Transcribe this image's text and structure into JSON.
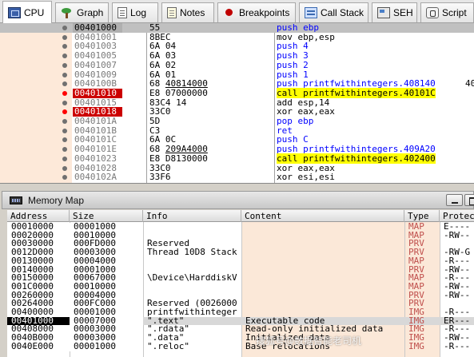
{
  "tabs": [
    {
      "label": "CPU",
      "icon": "cpu-icon",
      "active": true
    },
    {
      "label": "Graph",
      "icon": "graph-icon"
    },
    {
      "label": "Log",
      "icon": "log-icon"
    },
    {
      "label": "Notes",
      "icon": "notes-icon"
    },
    {
      "label": "Breakpoints",
      "icon": "breakpoints-icon"
    },
    {
      "label": "Call Stack",
      "icon": "call-stack-icon"
    },
    {
      "label": "SEH",
      "icon": "seh-icon"
    },
    {
      "label": "Script",
      "icon": "script-icon"
    }
  ],
  "disassembly": [
    {
      "addr": "00401000",
      "bytes": "55",
      "mnemonic": "push",
      "operand": "ebp",
      "kind": "push",
      "bp": false,
      "current": true
    },
    {
      "addr": "00401001",
      "bytes": "8BEC",
      "mnemonic": "mov",
      "operand": "ebp,esp",
      "kind": "plain",
      "bp": false
    },
    {
      "addr": "00401003",
      "bytes": "6A 04",
      "mnemonic": "push",
      "operand": "4",
      "kind": "push",
      "bp": false
    },
    {
      "addr": "00401005",
      "bytes": "6A 03",
      "mnemonic": "push",
      "operand": "3",
      "kind": "push",
      "bp": false
    },
    {
      "addr": "00401007",
      "bytes": "6A 02",
      "mnemonic": "push",
      "operand": "2",
      "kind": "push",
      "bp": false
    },
    {
      "addr": "00401009",
      "bytes": "6A 01",
      "mnemonic": "push",
      "operand": "1",
      "kind": "push",
      "bp": false
    },
    {
      "addr": "0040100B",
      "bytes": "68 ",
      "bytes_ul": "40814000",
      "mnemonic": "push",
      "operand": "printfwithintegers.408140",
      "kind": "push",
      "bp": false,
      "far": "40"
    },
    {
      "addr": "00401010",
      "bytes": "E8 07000000",
      "mnemonic": "call",
      "operand": "printfwithintegers.40101C",
      "kind": "call",
      "bp": true
    },
    {
      "addr": "00401015",
      "bytes": "83C4 14",
      "mnemonic": "add",
      "operand": "esp,14",
      "kind": "plain",
      "bp": false
    },
    {
      "addr": "00401018",
      "bytes": "33C0",
      "mnemonic": "xor",
      "operand": "eax,eax",
      "kind": "plain",
      "bp": true
    },
    {
      "addr": "0040101A",
      "bytes": "5D",
      "mnemonic": "pop",
      "operand": "ebp",
      "kind": "push",
      "bp": false
    },
    {
      "addr": "0040101B",
      "bytes": "C3",
      "mnemonic": "ret",
      "operand": "",
      "kind": "ret",
      "bp": false
    },
    {
      "addr": "0040101C",
      "bytes": "6A 0C",
      "mnemonic": "push",
      "operand": "C",
      "kind": "push",
      "bp": false
    },
    {
      "addr": "0040101E",
      "bytes": "68 ",
      "bytes_ul": "209A4000",
      "mnemonic": "push",
      "operand": "printfwithintegers.409A20",
      "kind": "push",
      "bp": false
    },
    {
      "addr": "00401023",
      "bytes": "E8 D8130000",
      "mnemonic": "call",
      "operand": "printfwithintegers.402400",
      "kind": "call",
      "bp": false
    },
    {
      "addr": "00401028",
      "bytes": "33C0",
      "mnemonic": "xor",
      "operand": "eax,eax",
      "kind": "plain",
      "bp": false
    },
    {
      "addr": "0040102A",
      "bytes": "33F6",
      "mnemonic": "xor",
      "operand": "esi,esi",
      "kind": "plain",
      "bp": false
    }
  ],
  "memory_map": {
    "title": "Memory Map",
    "columns": [
      "Address",
      "Size",
      "Info",
      "Content",
      "Type",
      "Protec"
    ],
    "rows": [
      {
        "address": "00010000",
        "size": "00001000",
        "info": "",
        "content": "",
        "type": "MAP",
        "prot": "E----"
      },
      {
        "address": "00020000",
        "size": "00010000",
        "info": "",
        "content": "",
        "type": "MAP",
        "prot": "-RW--"
      },
      {
        "address": "00030000",
        "size": "000FD000",
        "info": "Reserved",
        "content": "",
        "type": "PRV",
        "prot": ""
      },
      {
        "address": "0012D000",
        "size": "00003000",
        "info": "Thread 10D8 Stack",
        "content": "",
        "type": "PRV",
        "prot": "-RW-G"
      },
      {
        "address": "00130000",
        "size": "00004000",
        "info": "",
        "content": "",
        "type": "MAP",
        "prot": "-R---"
      },
      {
        "address": "00140000",
        "size": "00001000",
        "info": "",
        "content": "",
        "type": "PRV",
        "prot": "-RW--"
      },
      {
        "address": "00150000",
        "size": "00067000",
        "info": "\\Device\\HarddiskV",
        "content": "",
        "type": "MAP",
        "prot": "-R---"
      },
      {
        "address": "001C0000",
        "size": "00010000",
        "info": "",
        "content": "",
        "type": "MAP",
        "prot": "-RW--"
      },
      {
        "address": "00260000",
        "size": "00004000",
        "info": "",
        "content": "",
        "type": "PRV",
        "prot": "-RW--"
      },
      {
        "address": "00264000",
        "size": "000FC000",
        "info": "Reserved (0026000",
        "content": "",
        "type": "PRV",
        "prot": ""
      },
      {
        "address": "00400000",
        "size": "00001000",
        "info": "printfwithinteger",
        "content": "",
        "type": "IMG",
        "prot": "-R---"
      },
      {
        "address": "00401000",
        "size": "00007000",
        "info": "\".text\"",
        "content": "Executable code",
        "type": "IMG",
        "prot": "ER---",
        "selected": true
      },
      {
        "address": "00408000",
        "size": "00003000",
        "info": "\".rdata\"",
        "content": "Read-only initialized data",
        "type": "IMG",
        "prot": "-R---"
      },
      {
        "address": "0040B000",
        "size": "00003000",
        "info": "\".data\"",
        "content": "Initialized data",
        "type": "IMG",
        "prot": "-RW--"
      },
      {
        "address": "0040E000",
        "size": "00001000",
        "info": "\".reloc\"",
        "content": "Base relocations",
        "type": "IMG",
        "prot": "-R---"
      }
    ]
  },
  "watermark": "搜狐号@数据智能老司机"
}
